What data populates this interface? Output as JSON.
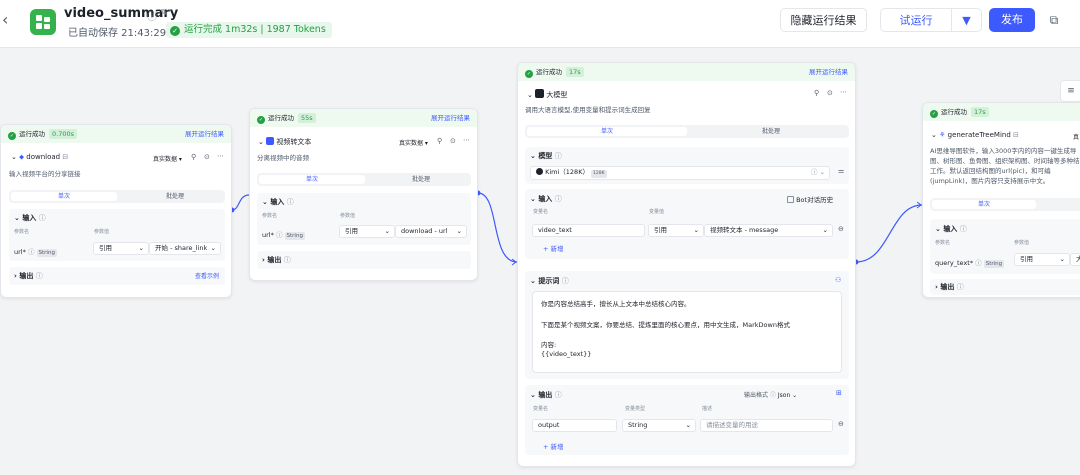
{
  "header": {
    "title": "video_summary",
    "autosave": "已自动保存 21:43:29",
    "run_status": "运行完成 1m32s | 1987 Tokens",
    "hide_results": "隐藏运行结果",
    "try_run": "试运行",
    "publish": "发布"
  },
  "colors": {
    "accent": "#3d5afe",
    "success": "#23a043",
    "logo": "#35b24b"
  },
  "common": {
    "run_ok": "运行成功",
    "expand_results": "展开运行结果",
    "tab_single": "单次",
    "tab_batch": "批处理",
    "input": "输入",
    "output": "输出",
    "param_name": "参数名",
    "param_value": "参数值",
    "ref": "引用",
    "real_data": "真实数据",
    "add": "+ 新增"
  },
  "node1": {
    "time": "0.700s",
    "name": "download",
    "desc": "输入视频平台的分享链接",
    "param": "url*",
    "type": "String",
    "value": "开始 - share_link",
    "view_example": "查看示例"
  },
  "node2": {
    "time": "55s",
    "name": "视频转文本",
    "desc": "分离视频中的音频",
    "param": "url*",
    "type": "String",
    "value": "download - url"
  },
  "node3": {
    "time": "17s",
    "name": "大模型",
    "desc": "调用大语言模型,使用变量和提示词生成回复",
    "model_label": "模型",
    "model": "Kimi（128K）",
    "model_tag": "128K",
    "bot_history": "Bot对话历史",
    "param": "video_text",
    "value": "视频转文本 - message",
    "var_name": "变量名",
    "var_value": "变量值",
    "prompt_label": "提示词",
    "prompt_line1": "你是内容总结高手，擅长从上文本中总结核心内容。",
    "prompt_line2": "下面是某个视频文案，你要总结、提炼里面的核心要点，用中文生成，MarkDown格式",
    "prompt_line3": "内容:",
    "prompt_var": "{{video_text}}",
    "output_format_label": "输出格式",
    "output_format": "Json",
    "out_var_type": "变量类型",
    "out_desc": "描述",
    "out_name": "output",
    "out_type": "String",
    "out_desc_placeholder": "请描述变量的用途"
  },
  "node4": {
    "time": "17s",
    "name": "generateTreeMind",
    "real_data_partial": "真",
    "desc_line1": "AI思维导图软件，输入3000字内的内容一键生成导",
    "desc_line2": "图、树形图、鱼骨图、组织架构图、时间轴等多种结",
    "desc_line3": "工作。默认返回结构图的url(pic)，和可编",
    "desc_line4": "(jumpLink)，图片内容只支持展示中文。",
    "tab_single": "单次",
    "param": "query_text*",
    "type": "String",
    "value_partial": "大"
  }
}
